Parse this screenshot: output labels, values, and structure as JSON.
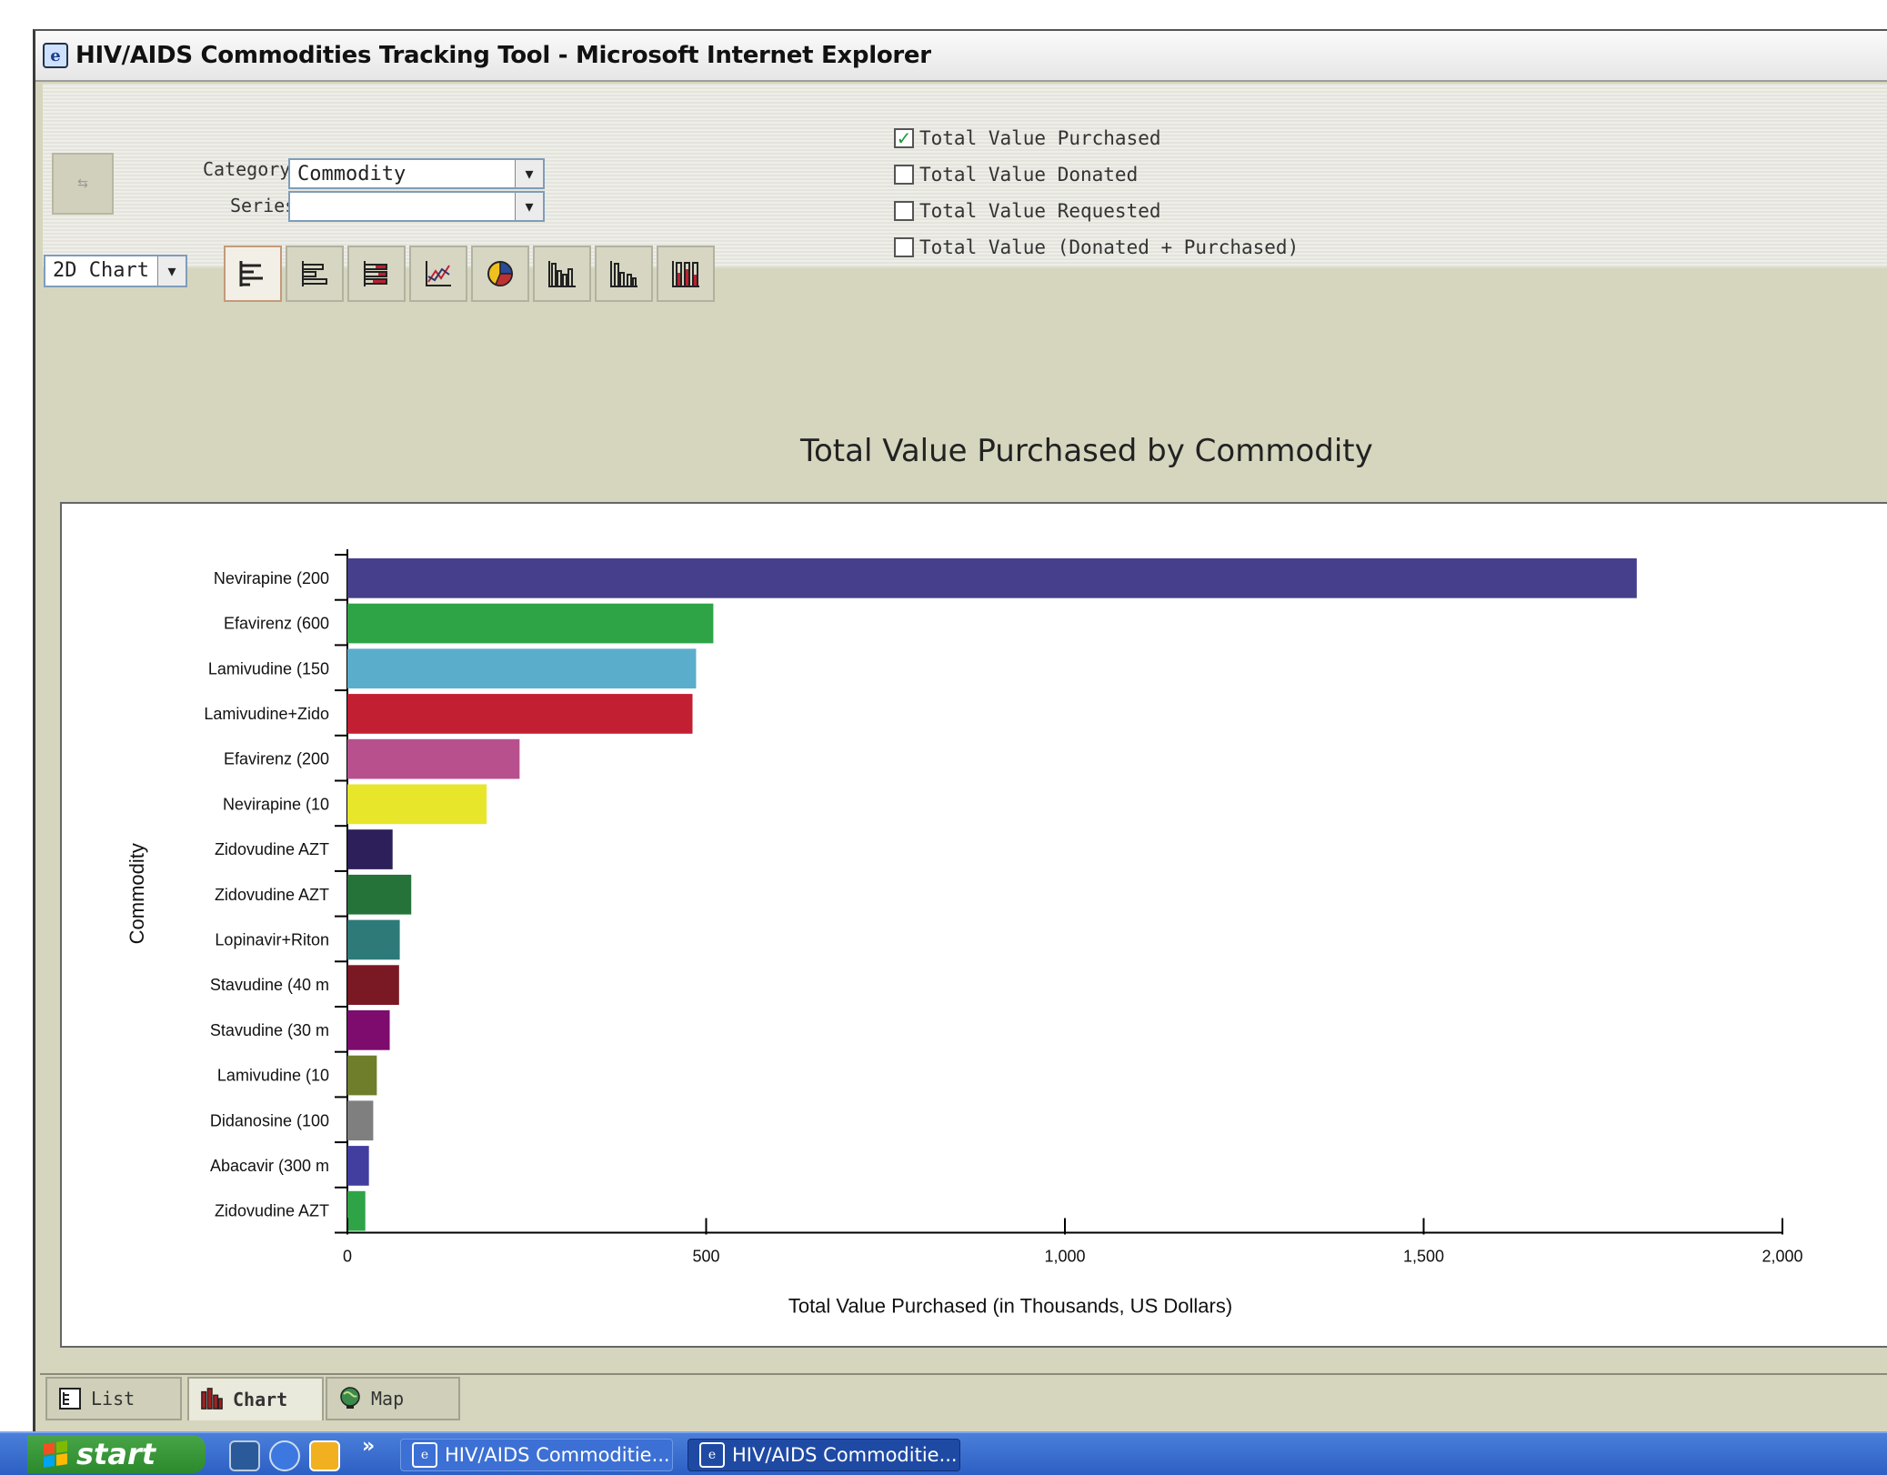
{
  "window": {
    "title": "HIV/AIDS Commodities Tracking Tool - Microsoft Internet Explorer",
    "icon": "ie-icon"
  },
  "filters": {
    "category_label": "Category",
    "category_value": "Commodity",
    "series_label": "Series",
    "series_value": ""
  },
  "checkboxes": [
    {
      "label": "Total Value Purchased",
      "checked": true
    },
    {
      "label": "Total Value Donated",
      "checked": false
    },
    {
      "label": "Total Value Requested",
      "checked": false
    },
    {
      "label": "Total Value (Donated + Purchased)",
      "checked": false
    }
  ],
  "chart_mode": "2D Chart",
  "chart_type_buttons": [
    "bar-horizontal",
    "bar-horizontal-outline",
    "bar-horizontal-stacked",
    "line",
    "pie",
    "column",
    "column-grouped",
    "column-stacked"
  ],
  "chart_data": {
    "type": "bar",
    "orientation": "horizontal",
    "title": "Total Value Purchased by Commodity",
    "xlabel": "Total Value Purchased  (in Thousands, US Dollars)",
    "ylabel": "Commodity",
    "xlim": [
      0,
      2000
    ],
    "xticks": [
      "0",
      "500",
      "1,000",
      "1,500",
      "2,000"
    ],
    "xtick_values": [
      0,
      500,
      1000,
      1500,
      2000
    ],
    "categories": [
      "Nevirapine (200",
      "Efavirenz (600",
      "Lamivudine (150",
      "Lamivudine+Zido",
      "Efavirenz (200",
      "Nevirapine (10",
      "Zidovudine AZT",
      "Zidovudine AZT",
      "Lopinavir+Riton",
      "Stavudine (40 m",
      "Stavudine (30 m",
      "Lamivudine (10",
      "Didanosine (100",
      "Abacavir (300 m",
      "Zidovudine AZT"
    ],
    "values": [
      1797,
      510,
      486,
      481,
      240,
      194,
      63,
      89,
      73,
      72,
      59,
      41,
      36,
      30,
      25
    ],
    "colors": [
      "#453f8c",
      "#2ea447",
      "#5aaecb",
      "#c31f32",
      "#b7508d",
      "#e7e62b",
      "#2c1f5a",
      "#267339",
      "#2e7a79",
      "#7a1824",
      "#7e0c6f",
      "#6f7e2b",
      "#7f7f7f",
      "#413ea0",
      "#2ea447"
    ],
    "grid": false,
    "legend": "none"
  },
  "tabs": [
    {
      "label": "List",
      "icon": "list-icon",
      "active": false
    },
    {
      "label": "Chart",
      "icon": "chart-icon",
      "active": true
    },
    {
      "label": "Map",
      "icon": "globe-icon",
      "active": false
    }
  ],
  "taskbar": {
    "start_label": "start",
    "overflow": "»",
    "tasks": [
      "HIV/AIDS Commoditie...",
      "HIV/AIDS Commoditie..."
    ]
  }
}
